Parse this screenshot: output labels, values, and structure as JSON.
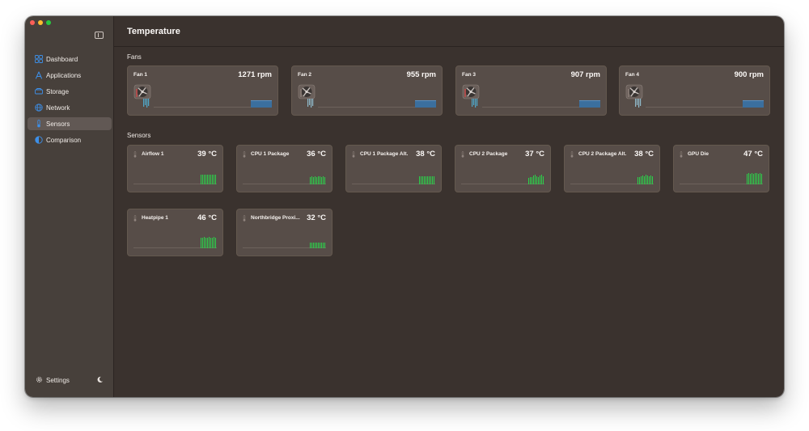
{
  "app": {
    "page_title": "Temperature"
  },
  "sidebar": {
    "items": [
      {
        "label": "Dashboard",
        "icon": "dashboard-icon",
        "active": false
      },
      {
        "label": "Applications",
        "icon": "applications-icon",
        "active": false
      },
      {
        "label": "Storage",
        "icon": "storage-icon",
        "active": false
      },
      {
        "label": "Network",
        "icon": "network-icon",
        "active": false
      },
      {
        "label": "Sensors",
        "icon": "thermometer-icon",
        "active": true
      },
      {
        "label": "Comparison",
        "icon": "comparison-icon",
        "active": false
      }
    ],
    "settings_label": "Settings"
  },
  "sections": {
    "fans": "Fans",
    "sensors": "Sensors"
  },
  "fans": [
    {
      "name": "Fan 1",
      "value": "1271 rpm"
    },
    {
      "name": "Fan 2",
      "value": "955 rpm"
    },
    {
      "name": "Fan 3",
      "value": "907 rpm"
    },
    {
      "name": "Fan 4",
      "value": "900 rpm"
    }
  ],
  "sensors": [
    {
      "name": "Airflow 1",
      "value": "39 °C"
    },
    {
      "name": "CPU 1 Package",
      "value": "36 °C"
    },
    {
      "name": "CPU 1 Package Alt.",
      "value": "38 °C"
    },
    {
      "name": "CPU 2 Package",
      "value": "37 °C"
    },
    {
      "name": "CPU 2 Package Alt.",
      "value": "38 °C"
    },
    {
      "name": "GPU Die",
      "value": "47 °C"
    },
    {
      "name": "Heatpipe 1",
      "value": "46 °C"
    },
    {
      "name": "Northbridge Proxi...",
      "value": "32 °C"
    }
  ],
  "colors": {
    "accent_blue": "#3b6f9e",
    "spark_green": "#2bd24a",
    "sidebar_icon_blue": "#3d8fe8"
  }
}
